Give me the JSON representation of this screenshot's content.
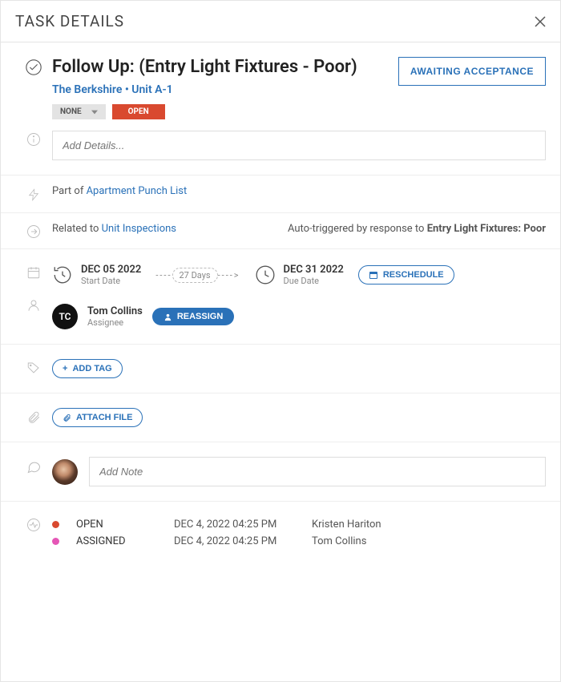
{
  "modal": {
    "title": "TASK DETAILS"
  },
  "task": {
    "title": "Follow Up: (Entry Light Fixtures - Poor)",
    "location": "The Berkshire • Unit A-1",
    "status_button": "AWAITING ACCEPTANCE",
    "priority_badge": "NONE",
    "status_badge": "OPEN",
    "details_placeholder": "Add Details..."
  },
  "partof": {
    "prefix": "Part of ",
    "link": "Apartment Punch List"
  },
  "related": {
    "prefix": "Related to ",
    "link": "Unit Inspections",
    "trigger_prefix": "Auto-triggered by response to ",
    "trigger_item": "Entry Light Fixtures: Poor"
  },
  "dates": {
    "start": "DEC 05 2022",
    "start_label": "Start Date",
    "duration": "27 Days",
    "due": "DEC 31 2022",
    "due_label": "Due Date",
    "reschedule": "RESCHEDULE"
  },
  "assignee": {
    "initials": "TC",
    "name": "Tom Collins",
    "label": "Assignee",
    "reassign": "REASSIGN"
  },
  "tags": {
    "add": "ADD TAG"
  },
  "attachments": {
    "attach": "ATTACH FILE"
  },
  "notes": {
    "placeholder": "Add Note"
  },
  "history": [
    {
      "status": "OPEN",
      "color": "red",
      "time": "DEC 4, 2022 04:25 PM",
      "who": "Kristen Hariton"
    },
    {
      "status": "ASSIGNED",
      "color": "pink",
      "time": "DEC 4, 2022 04:25 PM",
      "who": "Tom Collins"
    }
  ]
}
